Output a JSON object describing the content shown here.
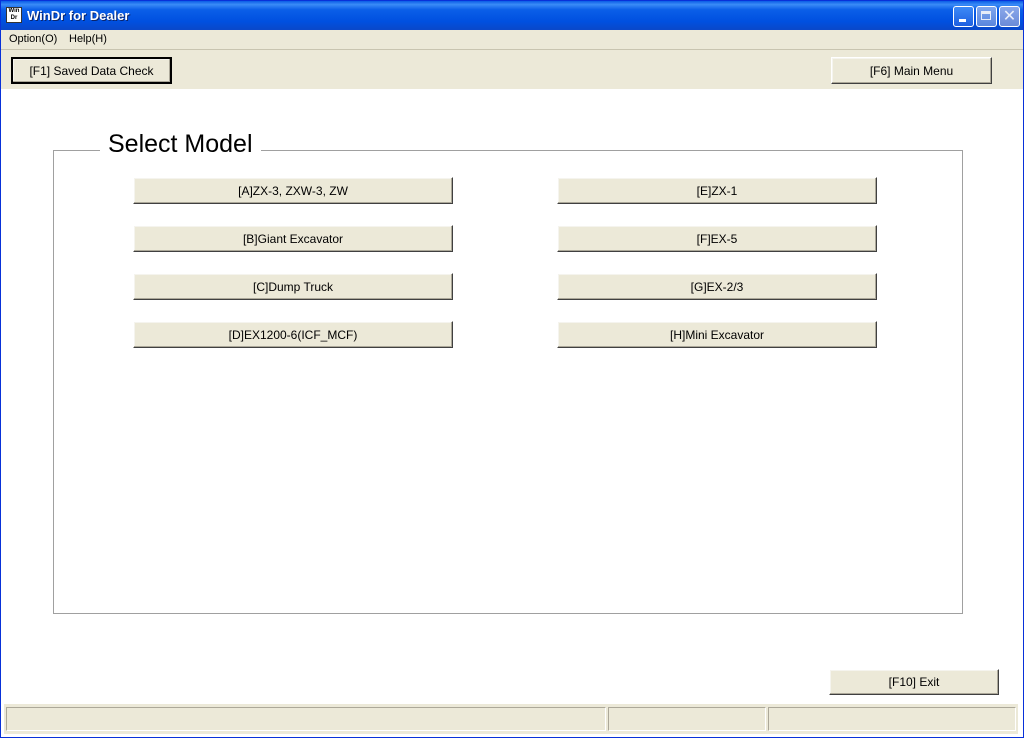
{
  "window": {
    "title": "WinDr for Dealer",
    "icon_text": "Win Dr"
  },
  "menu": {
    "items": [
      "Option(O)",
      "Help(H)"
    ]
  },
  "toolbar": {
    "saved_data_check": "[F1] Saved Data Check",
    "main_menu": "[F6] Main Menu"
  },
  "group": {
    "title": "Select Model"
  },
  "models": {
    "a": "[A]ZX-3, ZXW-3, ZW",
    "b": "[B]Giant Excavator",
    "c": "[C]Dump Truck",
    "d": "[D]EX1200-6(ICF_MCF)",
    "e": "[E]ZX-1",
    "f": "[F]EX-5",
    "g": "[G]EX-2/3",
    "h": "[H]Mini Excavator"
  },
  "footer": {
    "exit": "[F10] Exit"
  },
  "colors": {
    "titlebar": "#0050e0",
    "face": "#ece9d8",
    "border": "#0831d9"
  }
}
